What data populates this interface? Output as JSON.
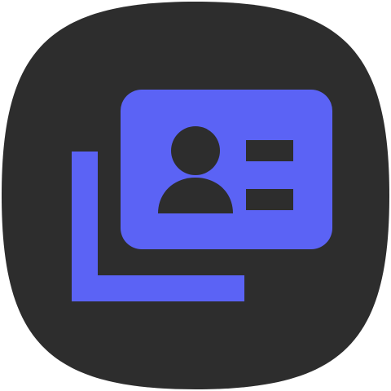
{
  "app_icon": {
    "icon": "contact-cards-icon",
    "background_color": "#2d2d2d",
    "accent_color": "#5b63f5"
  }
}
